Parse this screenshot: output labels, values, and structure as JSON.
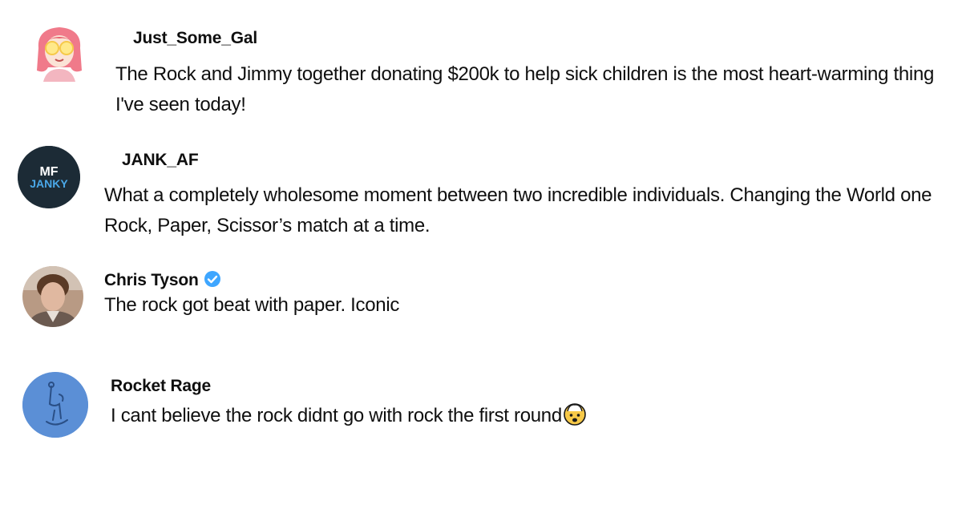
{
  "comments": [
    {
      "username": "Just_Some_Gal",
      "avatar": "cartoon-girl-with-glasses",
      "text": "The Rock and Jimmy together donating $200k to help sick children is the most heart-warming thing I've seen today!",
      "verified": false
    },
    {
      "username": "JANK_AF",
      "avatar": "mf-janky-logo",
      "avatar_text_line1": "MF",
      "avatar_text_line2": "JANKY",
      "text": "What a completely wholesome moment between two incredible individuals. Changing the World one Rock, Paper, Scissor’s match at a time.",
      "verified": false
    },
    {
      "username": "Chris Tyson",
      "avatar": "profile-photo",
      "text": "The rock got beat with paper. Iconic",
      "verified": true
    },
    {
      "username": "Rocket Rage",
      "avatar": "blue-sketch-avatar",
      "text": "I cant believe the rock didnt go with rock the first round",
      "emoji": "exploding-head-emoji",
      "verified": false
    }
  ],
  "colors": {
    "verified_badge": "#3ea6ff",
    "text": "#0f0f0f",
    "jank_avatar_bg": "#1c2b36",
    "rocket_avatar_bg": "#5b8fd6"
  }
}
